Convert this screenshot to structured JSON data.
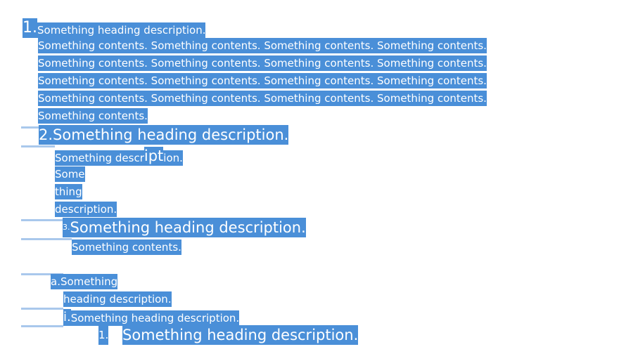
{
  "item1": {
    "marker": "1.",
    "heading": "Something heading description.",
    "contents": [
      "Something contents. Something contents. Something contents. Something contents.",
      "Something contents. Something contents. Something contents. Something contents.",
      "Something contents. Something contents. Something contents. Something contents.",
      "Something contents. Something contents. Something contents. Something contents.",
      "Something contents."
    ]
  },
  "item2": {
    "marker": "2.",
    "heading": "Something heading description.",
    "desc_start": "Something descr",
    "desc_big": "ipt",
    "desc_end": "ion.",
    "lines": [
      "Some",
      "thing",
      "description."
    ]
  },
  "item3": {
    "marker": "3.",
    "heading": "Something heading description.",
    "contents": "Something contents."
  },
  "item_a": {
    "marker": "a.",
    "line1": "Something",
    "line2": "heading description."
  },
  "item_i": {
    "marker": "i.",
    "heading": "Something heading description."
  },
  "item_1b": {
    "marker": "1.",
    "heading": "Something heading description."
  }
}
